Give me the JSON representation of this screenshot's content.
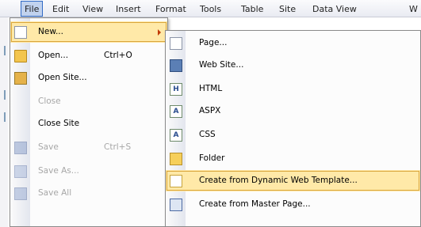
{
  "menubar": {
    "items": [
      "File",
      "Edit",
      "View",
      "Insert",
      "Format",
      "Tools",
      "Table",
      "Site",
      "Data View",
      "W"
    ]
  },
  "file_menu": {
    "items": [
      {
        "label": "New...",
        "shortcut": "",
        "icon": "new-page-icon",
        "enabled": true
      },
      {
        "label": "Open...",
        "shortcut": "Ctrl+O",
        "icon": "open-folder-icon",
        "enabled": true
      },
      {
        "label": "Open Site...",
        "shortcut": "",
        "icon": "open-site-icon",
        "enabled": true
      },
      {
        "label": "Close",
        "shortcut": "",
        "icon": "",
        "enabled": false
      },
      {
        "label": "Close Site",
        "shortcut": "",
        "icon": "",
        "enabled": true
      },
      {
        "label": "Save",
        "shortcut": "Ctrl+S",
        "icon": "save-icon",
        "enabled": false
      },
      {
        "label": "Save As...",
        "shortcut": "",
        "icon": "save-as-icon",
        "enabled": false
      },
      {
        "label": "Save All",
        "shortcut": "",
        "icon": "save-all-icon",
        "enabled": false
      }
    ]
  },
  "new_submenu": {
    "items": [
      {
        "label": "Page...",
        "icon": "page-icon",
        "glyph": ""
      },
      {
        "label": "Web Site...",
        "icon": "web-site-icon",
        "glyph": ""
      },
      {
        "label": "HTML",
        "icon": "html-icon",
        "glyph": "H"
      },
      {
        "label": "ASPX",
        "icon": "aspx-icon",
        "glyph": "A"
      },
      {
        "label": "CSS",
        "icon": "css-icon",
        "glyph": "A"
      },
      {
        "label": "Folder",
        "icon": "folder-icon",
        "glyph": ""
      },
      {
        "label": "Create from Dynamic Web Template...",
        "icon": "dynamic-web-template-icon",
        "glyph": ""
      },
      {
        "label": "Create from Master Page...",
        "icon": "master-page-icon",
        "glyph": ""
      }
    ]
  },
  "colors": {
    "highlight": "#ffe9a8",
    "menubar_active": "#c1d2ee",
    "submenu_arrow": "#c13a00"
  }
}
